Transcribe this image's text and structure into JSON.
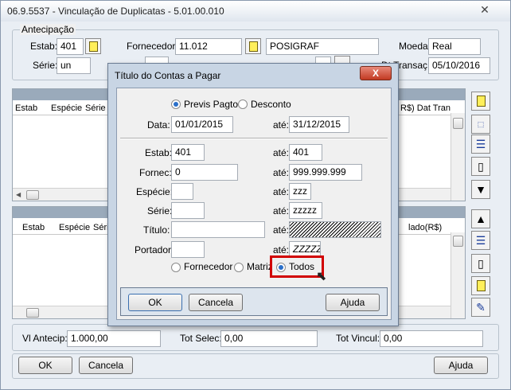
{
  "window": {
    "title": "06.9.5537 - Vinculação de Duplicatas - 5.01.00.010",
    "close_glyph": "✕"
  },
  "antecipacao": {
    "legend": "Antecipação",
    "estab_label": "Estab:",
    "estab_value": "401",
    "fornecedor_label": "Fornecedor:",
    "fornecedor_value": "11.012",
    "fornecedor_name": "POSIGRAF",
    "moeda_label": "Moeda:",
    "moeda_value": "Real",
    "serie_label": "Série:",
    "serie_value": "un",
    "dt_transac_label": "Dt Transaç:",
    "dt_transac_value": "05/10/2016"
  },
  "grid_top": {
    "col_estab": "Estab",
    "col_especie": "Espécie",
    "col_serie": "Série",
    "col_right": "R$)  Dat Tran"
  },
  "grid_bottom": {
    "col_estab": "Estab",
    "col_especie": "Espécie",
    "col_serie": "Série",
    "col_right": "lado(R$)"
  },
  "footer": {
    "vl_antecip_label": "Vl Antecip:",
    "vl_antecip_value": "1.000,00",
    "tot_selec_label": "Tot Selec:",
    "tot_selec_value": "0,00",
    "tot_vincul_label": "Tot Vincul:",
    "tot_vincul_value": "0,00",
    "ok": "OK",
    "cancela": "Cancela",
    "ajuda": "Ajuda"
  },
  "dialog": {
    "title": "Título do Contas a Pagar",
    "close_glyph": "X",
    "previs_pagto": "Previs Pagto",
    "desconto": "Desconto",
    "data_label": "Data:",
    "data_from": "01/01/2015",
    "ate": "até:",
    "data_to": "31/12/2015",
    "estab_label": "Estab:",
    "estab_from": "401",
    "estab_to": "401",
    "fornec_label": "Fornec:",
    "fornec_from": "0",
    "fornec_to": "999.999.999",
    "especie_label": "Espécie:",
    "especie_from": "",
    "especie_to": "zzz",
    "serie_label": "Série:",
    "serie_from": "",
    "serie_to": "zzzzz",
    "titulo_label": "Título:",
    "titulo_from": "",
    "portador_label": "Portador:",
    "portador_from": "",
    "portador_to": "ZZZZZ",
    "fornecedor_radio": "Fornecedor",
    "matriz_radio": "Matriz",
    "todos_radio": "Todos",
    "ok": "OK",
    "cancela": "Cancela",
    "ajuda": "Ajuda"
  }
}
